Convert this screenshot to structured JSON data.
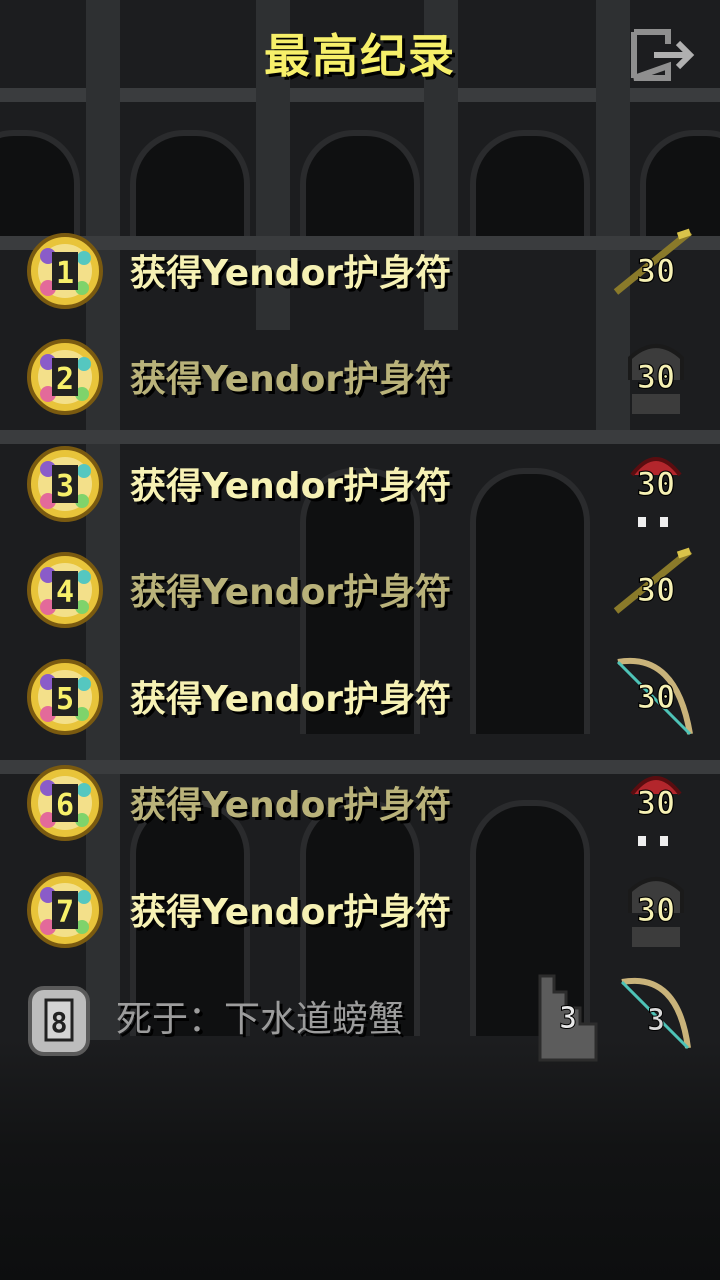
{
  "title": "最高纪录",
  "records": [
    {
      "rank": "1",
      "label": "获得Yendor护身符",
      "level": "30",
      "state": "bright",
      "class_icon": "staff-icon"
    },
    {
      "rank": "2",
      "label": "获得Yendor护身符",
      "level": "30",
      "state": "dim",
      "class_icon": "helmet-icon"
    },
    {
      "rank": "3",
      "label": "获得Yendor护身符",
      "level": "30",
      "state": "bright",
      "class_icon": "red-hood-icon"
    },
    {
      "rank": "4",
      "label": "获得Yendor护身符",
      "level": "30",
      "state": "dim",
      "class_icon": "staff-icon"
    },
    {
      "rank": "5",
      "label": "获得Yendor护身符",
      "level": "30",
      "state": "bright",
      "class_icon": "bow-icon"
    },
    {
      "rank": "6",
      "label": "获得Yendor护身符",
      "level": "30",
      "state": "dim",
      "class_icon": "red-hood-icon"
    },
    {
      "rank": "7",
      "label": "获得Yendor护身符",
      "level": "30",
      "state": "bright",
      "class_icon": "helmet-icon"
    }
  ],
  "latest": {
    "rank": "8",
    "label": "死于：下水道螃蟹",
    "depth": "3",
    "level": "3",
    "class_icon": "bow-icon"
  },
  "colors": {
    "title": "#f7f06a",
    "bright_text": "#f6f1b4",
    "dim_text": "#b9b27a",
    "dead_text": "#9c9c9c"
  }
}
